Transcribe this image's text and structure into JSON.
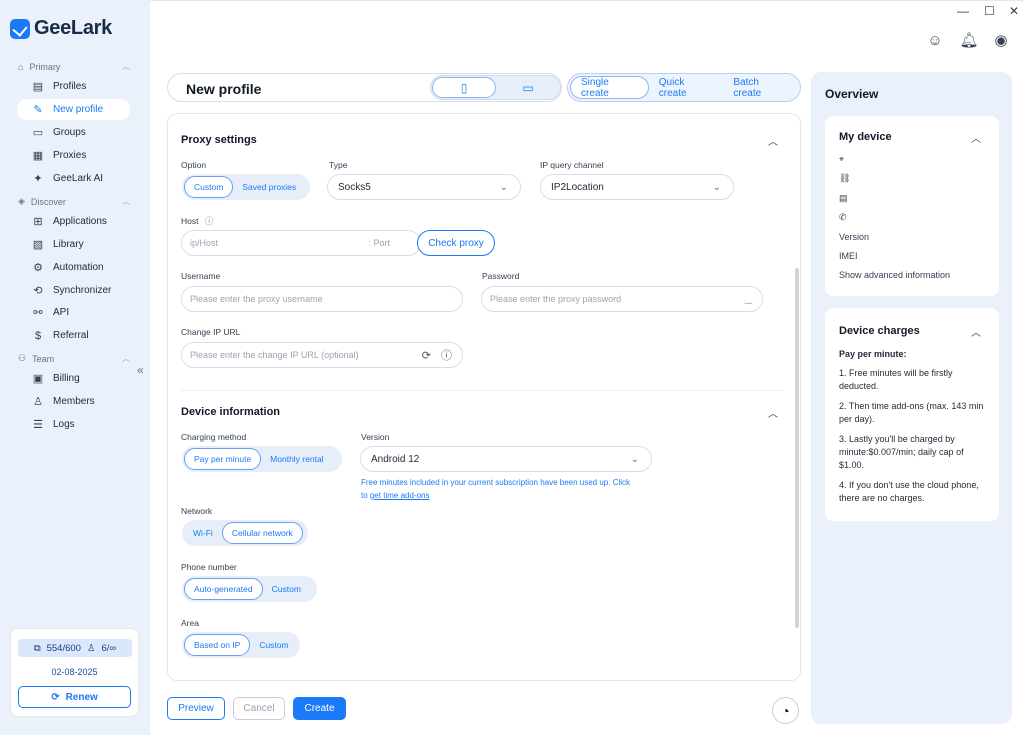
{
  "app": {
    "name": "GeeLark"
  },
  "window_controls": {
    "minimize": "—",
    "maximize": "☐",
    "close": "✕"
  },
  "sidebar": {
    "sections": [
      {
        "label": "Primary"
      },
      {
        "label": "Discover"
      },
      {
        "label": "Team"
      }
    ],
    "items": [
      {
        "label": "Profiles"
      },
      {
        "label": "New profile"
      },
      {
        "label": "Groups"
      },
      {
        "label": "Proxies"
      },
      {
        "label": "GeeLark AI"
      },
      {
        "label": "Applications"
      },
      {
        "label": "Library"
      },
      {
        "label": "Automation"
      },
      {
        "label": "Synchronizer"
      },
      {
        "label": "API"
      },
      {
        "label": "Referral"
      },
      {
        "label": "Billing"
      },
      {
        "label": "Members"
      },
      {
        "label": "Logs"
      }
    ],
    "usage": {
      "profiles": "554/600",
      "members": "6/∞",
      "date": "02-08-2025",
      "renew_label": "Renew"
    }
  },
  "header": {
    "title": "New profile",
    "modes": [
      "Single create",
      "Quick create",
      "Batch create"
    ],
    "selected_mode": "Single create"
  },
  "proxy": {
    "section_title": "Proxy settings",
    "option_label": "Option",
    "option_custom": "Custom",
    "option_saved": "Saved proxies",
    "type_label": "Type",
    "type_value": "Socks5",
    "channel_label": "IP query channel",
    "channel_value": "IP2Location",
    "host_label": "Host",
    "host_placeholder": "ip/Host",
    "port_placeholder": ": Port",
    "check_label": "Check proxy",
    "username_label": "Username",
    "username_placeholder": "Please enter the proxy username",
    "password_label": "Password",
    "password_placeholder": "Please enter the proxy password",
    "change_ip_label": "Change IP URL",
    "change_ip_placeholder": "Please enter the change IP URL (optional)"
  },
  "device": {
    "section_title": "Device information",
    "charging_label": "Charging method",
    "charging_options": [
      "Pay per minute",
      "Monthly rental"
    ],
    "version_label": "Version",
    "version_value": "Android 12",
    "version_note_line1": "Free minutes included in your current subscription have been used up. Click",
    "version_note_prefix": "to ",
    "version_note_link": "get time add-ons",
    "network_label": "Network",
    "network_options": [
      "Wi-Fi",
      "Cellular network"
    ],
    "phone_label": "Phone number",
    "phone_options": [
      "Auto-generated",
      "Custom"
    ],
    "area_label": "Area",
    "area_options": [
      "Based on IP",
      "Custom"
    ]
  },
  "footer": {
    "preview": "Preview",
    "cancel": "Cancel",
    "create": "Create"
  },
  "overview": {
    "title": "Overview",
    "my_device": {
      "title": "My device",
      "version_label": "Version",
      "imei_label": "IMEI",
      "advanced_label": "Show advanced information"
    },
    "charges": {
      "title": "Device charges",
      "heading": "Pay per minute:",
      "items": [
        "1. Free minutes will be firstly deducted.",
        "2. Then time add-ons (max. 143 min per day).",
        "3. Lastly you'll be charged by minute:$0.007/min; daily cap of $1.00.",
        "4. If you don't use the cloud phone, there are no charges."
      ]
    }
  },
  "colors": {
    "accent": "#1a7af8",
    "sidebar_bg": "#eaf1fb",
    "selected_pill_bg": "#e6eefa"
  }
}
